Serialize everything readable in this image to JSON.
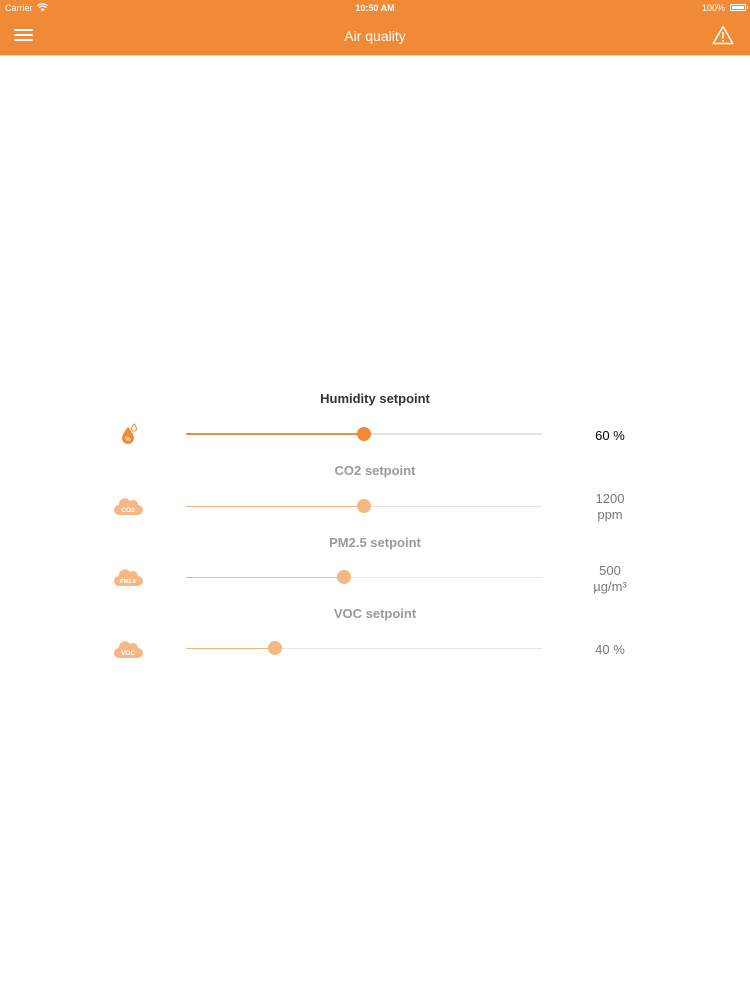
{
  "status_bar": {
    "carrier": "Carrier",
    "time": "10:50 AM",
    "battery": "100%"
  },
  "nav": {
    "title": "Air quality",
    "menu_icon": "hamburger-menu-icon",
    "alert_icon": "warning-triangle-icon"
  },
  "colors": {
    "accent": "#f08a36",
    "accent_light": "#f5b883",
    "track": "#e2e2e2"
  },
  "setpoints": [
    {
      "title": "Humidity setpoint",
      "icon": "humidity-drop-icon",
      "value": "60 %",
      "unit": "",
      "level": 0.5,
      "active": true
    },
    {
      "title": "CO2 setpoint",
      "icon": "co2-cloud-icon",
      "icon_text": "CO2",
      "value": "1200",
      "unit": "ppm",
      "level": 0.5,
      "active": false
    },
    {
      "title": "PM2.5 setpoint",
      "icon": "pm25-cloud-icon",
      "icon_text": "PM2.5",
      "value": "500",
      "unit": "µg/m³",
      "level": 0.445,
      "active": false
    },
    {
      "title": "VOC setpoint",
      "icon": "voc-cloud-icon",
      "icon_text": "VOC",
      "value": "40 %",
      "unit": "",
      "level": 0.25,
      "active": false
    }
  ]
}
